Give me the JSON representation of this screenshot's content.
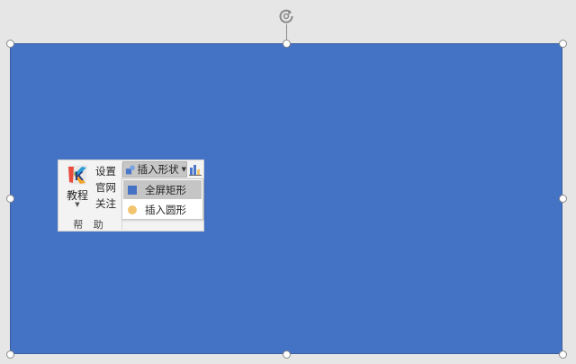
{
  "canvas": {
    "shape_fill": "#4472c4",
    "background": "#e6e6e6"
  },
  "selection": {
    "rotate_icon": "rotate-handle-icon",
    "handles": [
      "top-left",
      "top-center",
      "top-right",
      "middle-left",
      "middle-right",
      "bottom-left",
      "bottom-center",
      "bottom-right"
    ]
  },
  "ribbon": {
    "tutorial": {
      "label": "教程",
      "icon": "k-logo-icon"
    },
    "links": [
      "设置",
      "官网",
      "关注"
    ],
    "group_label": "帮 助",
    "insert_shape": {
      "label": "插入形状",
      "icon": "shapes-icon"
    },
    "next_icon": "chart-icon",
    "dropdown": {
      "items": [
        {
          "label": "全屏矩形",
          "icon": "square-icon",
          "color": "#4472c4",
          "hovered": true
        },
        {
          "label": "插入圆形",
          "icon": "circle-icon",
          "color": "#f2c46f",
          "hovered": false
        }
      ]
    }
  }
}
